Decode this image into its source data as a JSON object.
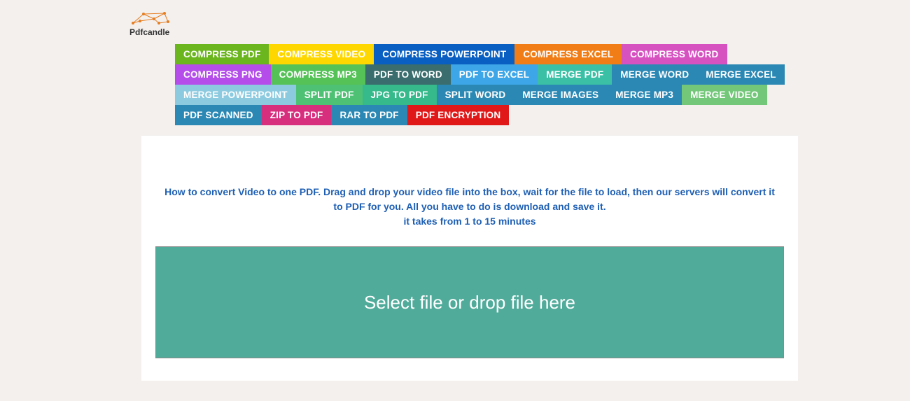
{
  "logo": {
    "text": "Pdfcandle"
  },
  "nav": [
    {
      "label": "COMPRESS PDF",
      "color": "#6bb61f"
    },
    {
      "label": "COMPRESS VIDEO",
      "color": "#ffd700"
    },
    {
      "label": "COMPRESS POWERPOINT",
      "color": "#0a5fc2"
    },
    {
      "label": "COMPRESS EXCEL",
      "color": "#f07d16"
    },
    {
      "label": "COMPRESS WORD",
      "color": "#d752c1"
    },
    {
      "label": "COMPRESS PNG",
      "color": "#b44dea"
    },
    {
      "label": "COMPRESS MP3",
      "color": "#54c257"
    },
    {
      "label": "PDF TO WORD",
      "color": "#3a6d6d"
    },
    {
      "label": "PDF TO EXCEL",
      "color": "#3da6e8"
    },
    {
      "label": "MERGE PDF",
      "color": "#3bc0a5"
    },
    {
      "label": "MERGE WORD",
      "color": "#2b88b4"
    },
    {
      "label": "MERGE EXCEL",
      "color": "#2b88b4"
    },
    {
      "label": "MERGE POWERPOINT",
      "color": "#8ccae0"
    },
    {
      "label": "SPLIT PDF",
      "color": "#4fc174"
    },
    {
      "label": "JPG TO PDF",
      "color": "#36b98b"
    },
    {
      "label": "SPLIT WORD",
      "color": "#2b88b4"
    },
    {
      "label": "MERGE IMAGES",
      "color": "#2b88b4"
    },
    {
      "label": "MERGE MP3",
      "color": "#2b88b4"
    },
    {
      "label": "MERGE VIDEO",
      "color": "#73c779"
    },
    {
      "label": "PDF SCANNED",
      "color": "#2b88b4"
    },
    {
      "label": "ZIP TO PDF",
      "color": "#d82e7e"
    },
    {
      "label": "RAR TO PDF",
      "color": "#2b88b4"
    },
    {
      "label": "PDF ENCRYPTION",
      "color": "#e01818"
    }
  ],
  "instructions": {
    "line1": "How to convert Video to one PDF. Drag and drop your video file into the box, wait for the file to load, then our servers will convert it to PDF for you. All you have to do is download and save it.",
    "line2": "it takes from 1 to 15 minutes"
  },
  "dropzone": {
    "label": "Select file or drop file here"
  }
}
